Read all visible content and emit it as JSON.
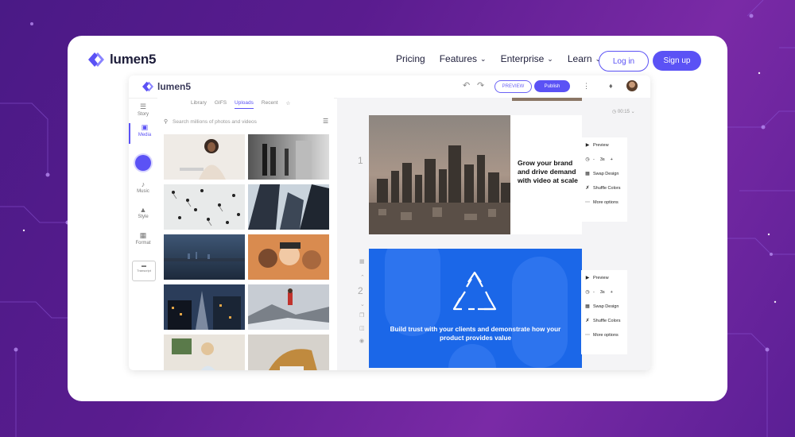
{
  "site": {
    "brand": "lumen5",
    "nav": [
      {
        "label": "Pricing",
        "dropdown": false
      },
      {
        "label": "Features",
        "dropdown": true
      },
      {
        "label": "Enterprise",
        "dropdown": true
      },
      {
        "label": "Learn",
        "dropdown": true
      }
    ],
    "login": "Log in",
    "signup": "Sign up",
    "accent": "#5b52f5"
  },
  "app": {
    "brand": "lumen5",
    "preview": "PREVIEW",
    "publish": "Publish",
    "sidebar": [
      "Story",
      "Media",
      "Music",
      "Style",
      "Format"
    ],
    "transcript": "Transcript",
    "tabs": [
      "Library",
      "GIFS",
      "Uploads",
      "Recent"
    ],
    "active_tab": "Uploads",
    "search_placeholder": "Search millions of photos and videos",
    "timer": "00:15",
    "slides": [
      {
        "number": "1",
        "title": "Grow your brand and drive demand with video at scale"
      },
      {
        "number": "2",
        "caption": "Build trust with your clients and demonstrate how your product provides value"
      }
    ],
    "options": {
      "preview": "Preview",
      "duration": "3s",
      "minus": "-",
      "plus": "+",
      "swap": "Swap Design",
      "shuffle": "Shuffle Colors",
      "more": "More options"
    },
    "slide2_color": "#1b67e8"
  }
}
